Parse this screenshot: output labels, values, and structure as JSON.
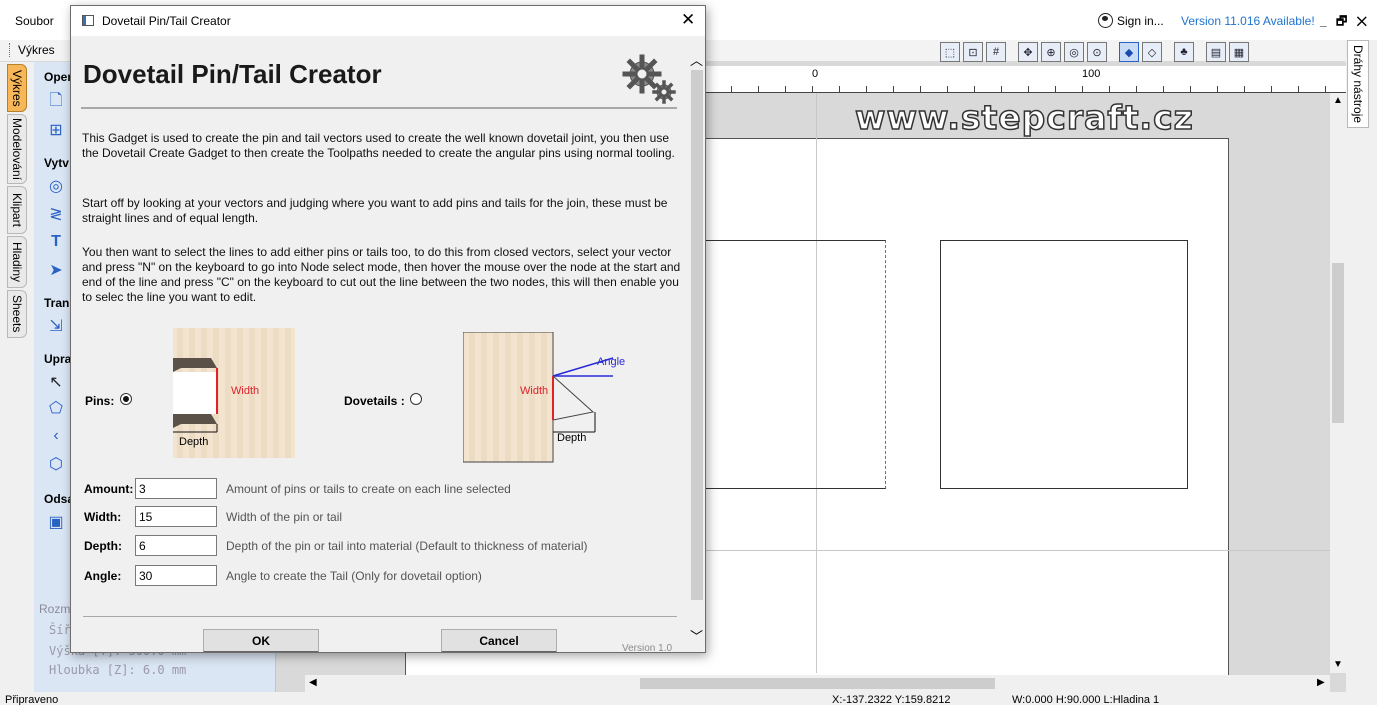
{
  "app": {
    "menu_file": "Soubor",
    "sign_in": "Sign in...",
    "version_available": "Version 11.016 Available!",
    "window_controls": "_ 🗗 ✕",
    "tab_drawing": "Výkres",
    "right_tab": "Dráhy nástroje"
  },
  "side_tabs": [
    "Výkres",
    "Modelování",
    "Klipart",
    "Hladiny",
    "Sheets"
  ],
  "left_panel": {
    "sections": [
      "Oper",
      "Vytv",
      "Trans",
      "Upra",
      "Odsa"
    ],
    "dims_label": "Rozm",
    "dims": [
      "Šíř",
      "Výška   [Y]: 300.0 mm",
      "Hloubka [Z]: 6.0 mm"
    ]
  },
  "canvas": {
    "ruler_labels": [
      "0",
      "100"
    ],
    "watermark": "www.stepcraft.cz"
  },
  "status": {
    "ready": "Připraveno",
    "coords": "X:-137.2322 Y:159.8212",
    "size": "W:0.000   H:90.000   L:Hladina 1"
  },
  "dialog": {
    "window_title": "Dovetail Pin/Tail Creator",
    "close_glyph": "✕",
    "heading": "Dovetail Pin/Tail Creator",
    "paragraphs": [
      "This Gadget is used to create the pin and tail vectors used to create the well known dovetail joint, you then use the Dovetail Create Gadget to then create the Toolpaths needed to create the angular pins using normal tooling.",
      "Start off by looking at your vectors and judging where you want to add pins and tails for the join, these must be straight lines and of equal length.",
      "You then want to select the lines to add either pins or tails too, to do this from closed vectors, select your vector and press \"N\" on the keyboard to go into Node select mode, then hover the mouse over the node at the start and end of the line and press \"C\" on the keyboard to cut out the line between the two nodes, this will then enable you to selec the line you want to edit."
    ],
    "options": {
      "pins_label": "Pins:",
      "pins_selected": true,
      "dovetails_label": "Dovetails :",
      "dovetails_selected": false
    },
    "diagram_labels": {
      "pin_width": "Width",
      "pin_depth": "Depth",
      "tail_width": "Width",
      "tail_depth": "Depth",
      "tail_angle": "Angle"
    },
    "fields": [
      {
        "label": "Amount:",
        "value": "3",
        "hint": "Amount of pins or tails to create on each line selected"
      },
      {
        "label": "Width:",
        "value": "15",
        "hint": "Width of the pin or tail"
      },
      {
        "label": "Depth:",
        "value": "6",
        "hint": "Depth of the pin or tail into material (Default to thickness of material)"
      },
      {
        "label": "Angle:",
        "value": "30",
        "hint": "Angle to create the Tail (Only for dovetail option)"
      }
    ],
    "ok_label": "OK",
    "cancel_label": "Cancel",
    "version": "Version 1.0"
  },
  "colors": {
    "accent_link": "#1e74d0",
    "active_tab": "#f7b657",
    "width_marker": "#e0202a",
    "angle_marker": "#2a2ad8"
  }
}
